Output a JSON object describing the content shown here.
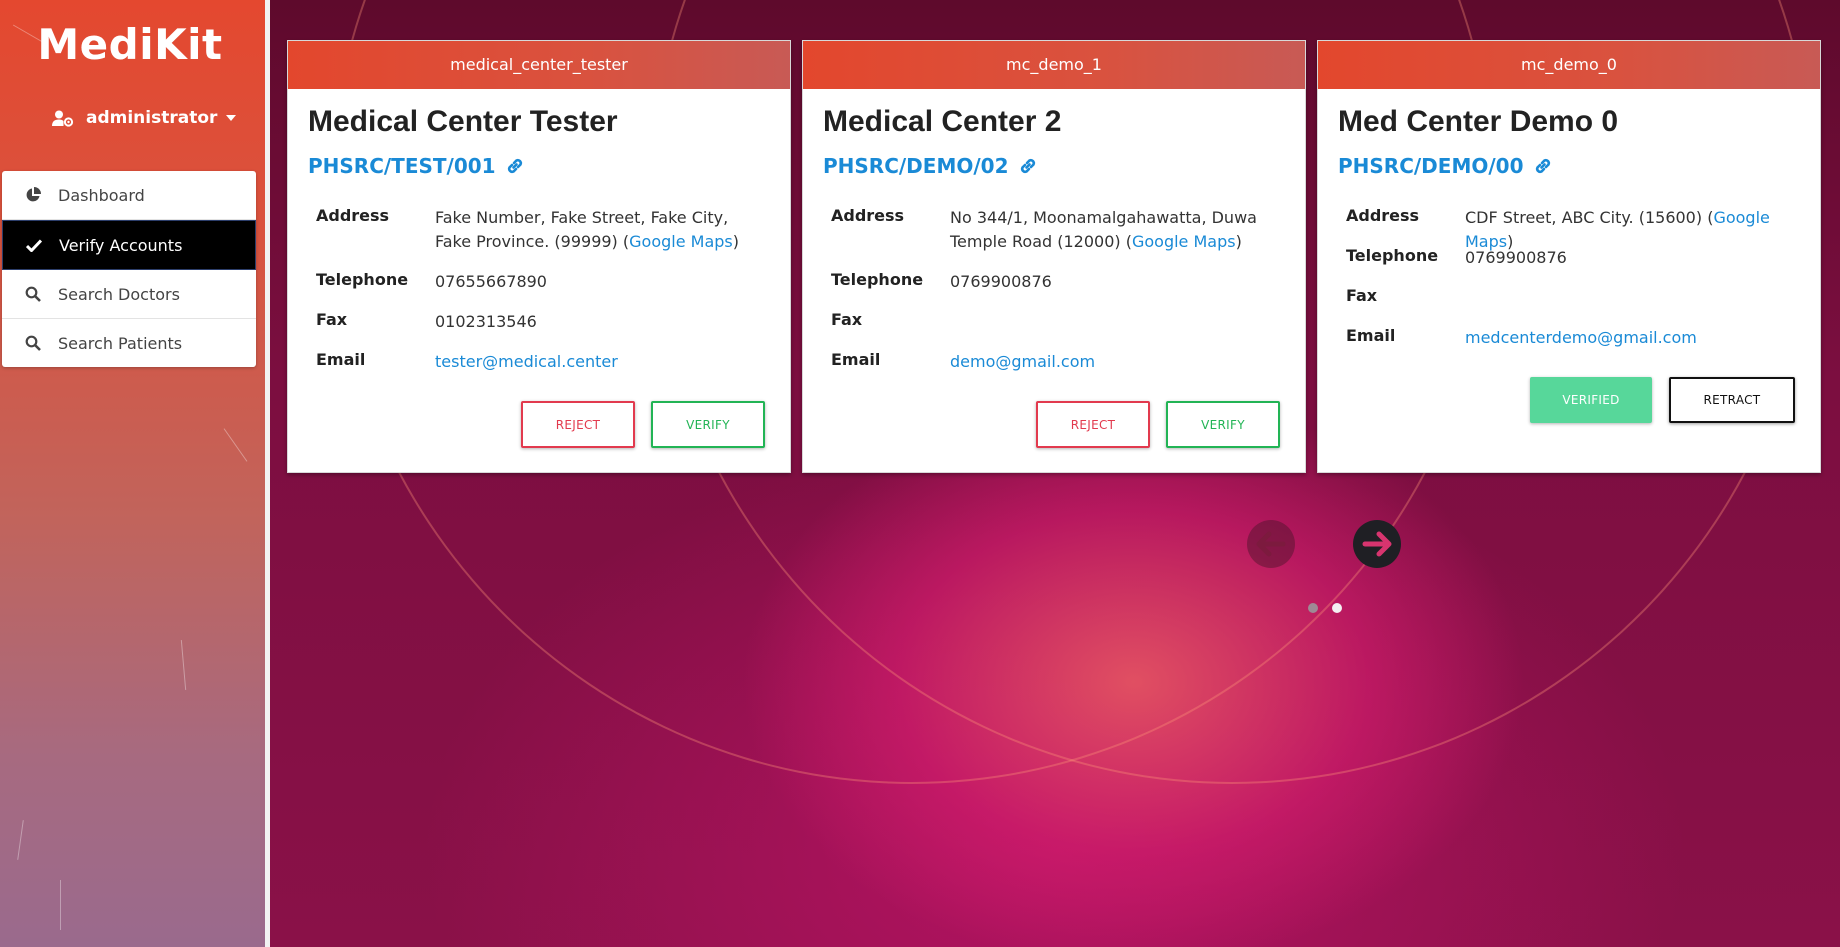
{
  "app": {
    "brand": "MediKit"
  },
  "user_menu": {
    "label": "administrator"
  },
  "sidebar": {
    "items": [
      {
        "label": "Dashboard",
        "icon": "pie-chart-icon",
        "active": false
      },
      {
        "label": "Verify Accounts",
        "icon": "check-icon",
        "active": true
      },
      {
        "label": "Search Doctors",
        "icon": "search-icon",
        "active": false
      },
      {
        "label": "Search Patients",
        "icon": "search-icon",
        "active": false
      }
    ]
  },
  "cards": [
    {
      "username": "medical_center_tester",
      "name": "Medical Center Tester",
      "code": "PHSRC/TEST/001",
      "labels": {
        "address": "Address",
        "telephone": "Telephone",
        "fax": "Fax",
        "email": "Email"
      },
      "address": "Fake Number, Fake Street, Fake City, Fake Province. (99999) (",
      "maps_link": "Google Maps",
      "address_close": ")",
      "telephone": "07655667890",
      "fax": "0102313546",
      "email": "tester@medical.center",
      "buttons": [
        "REJECT",
        "VERIFY"
      ]
    },
    {
      "username": "mc_demo_1",
      "name": "Medical Center 2",
      "code": "PHSRC/DEMO/02",
      "labels": {
        "address": "Address",
        "telephone": "Telephone",
        "fax": "Fax",
        "email": "Email"
      },
      "address": "No 344/1, Moonamalgahawatta, Duwa Temple Road (12000) (",
      "maps_link": "Google Maps",
      "address_close": ")",
      "telephone": "0769900876",
      "fax": "",
      "email": "demo@gmail.com",
      "buttons": [
        "REJECT",
        "VERIFY"
      ]
    },
    {
      "username": "mc_demo_0",
      "name": "Med Center Demo 0",
      "code": "PHSRC/DEMO/00",
      "labels": {
        "address": "Address",
        "telephone": "Telephone",
        "fax": "Fax",
        "email": "Email"
      },
      "address": "CDF Street, ABC City. (15600) (",
      "maps_link": "Google Maps",
      "address_close": ")",
      "telephone": "0769900876",
      "fax": "",
      "email": "medcenterdemo@gmail.com",
      "buttons": [
        "VERIFIED",
        "RETRACT"
      ]
    }
  ],
  "carousel": {
    "prev_icon": "arrow-left-icon",
    "next_icon": "arrow-right-icon",
    "active_page": 2,
    "page_count": 2
  },
  "colors": {
    "accent_header": "#e3472d",
    "link": "#1a8ad6",
    "reject": "#e23a4e",
    "verify": "#22b455",
    "verified": "#57d79a"
  }
}
